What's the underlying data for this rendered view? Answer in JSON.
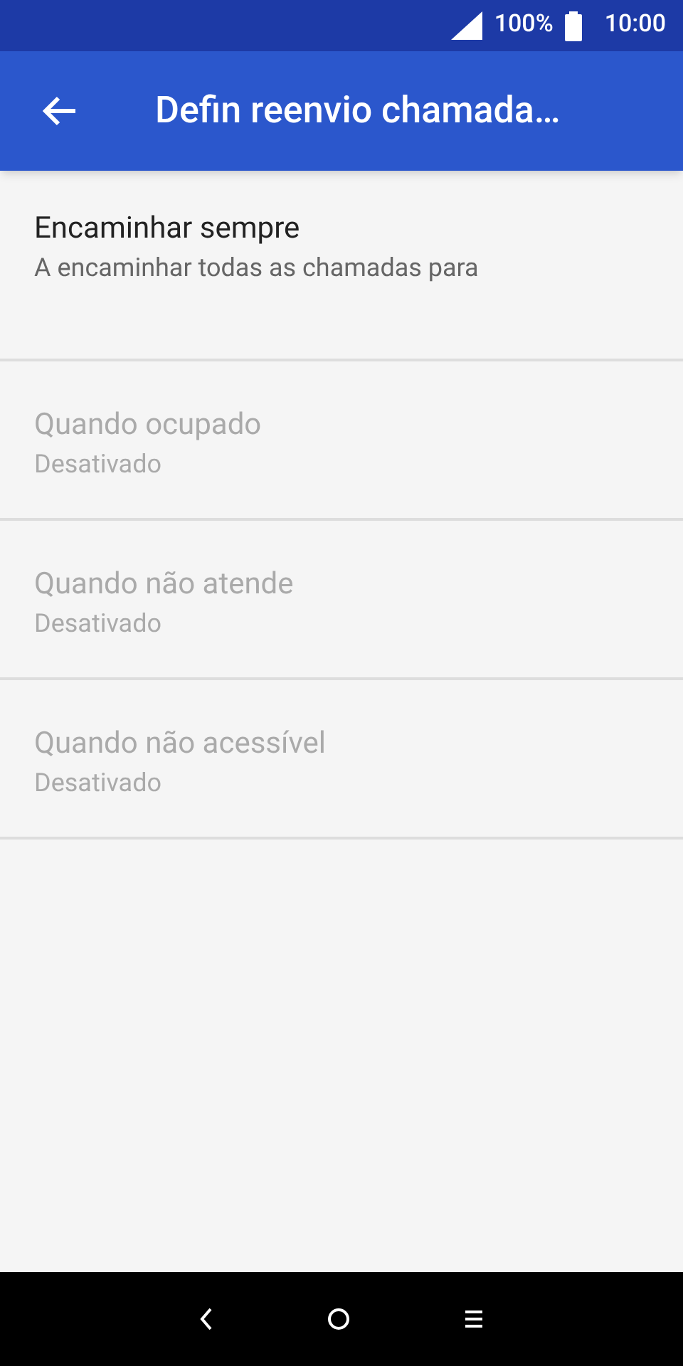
{
  "status_bar": {
    "battery": "100%",
    "time": "10:00"
  },
  "app_bar": {
    "title": "Defin reenvio chamada…"
  },
  "items": [
    {
      "title": "Encaminhar sempre",
      "summary": "A encaminhar todas as chamadas para",
      "disabled": false
    },
    {
      "title": "Quando ocupado",
      "summary": "Desativado",
      "disabled": true
    },
    {
      "title": "Quando não atende",
      "summary": "Desativado",
      "disabled": true
    },
    {
      "title": "Quando não acessível",
      "summary": "Desativado",
      "disabled": true
    }
  ]
}
